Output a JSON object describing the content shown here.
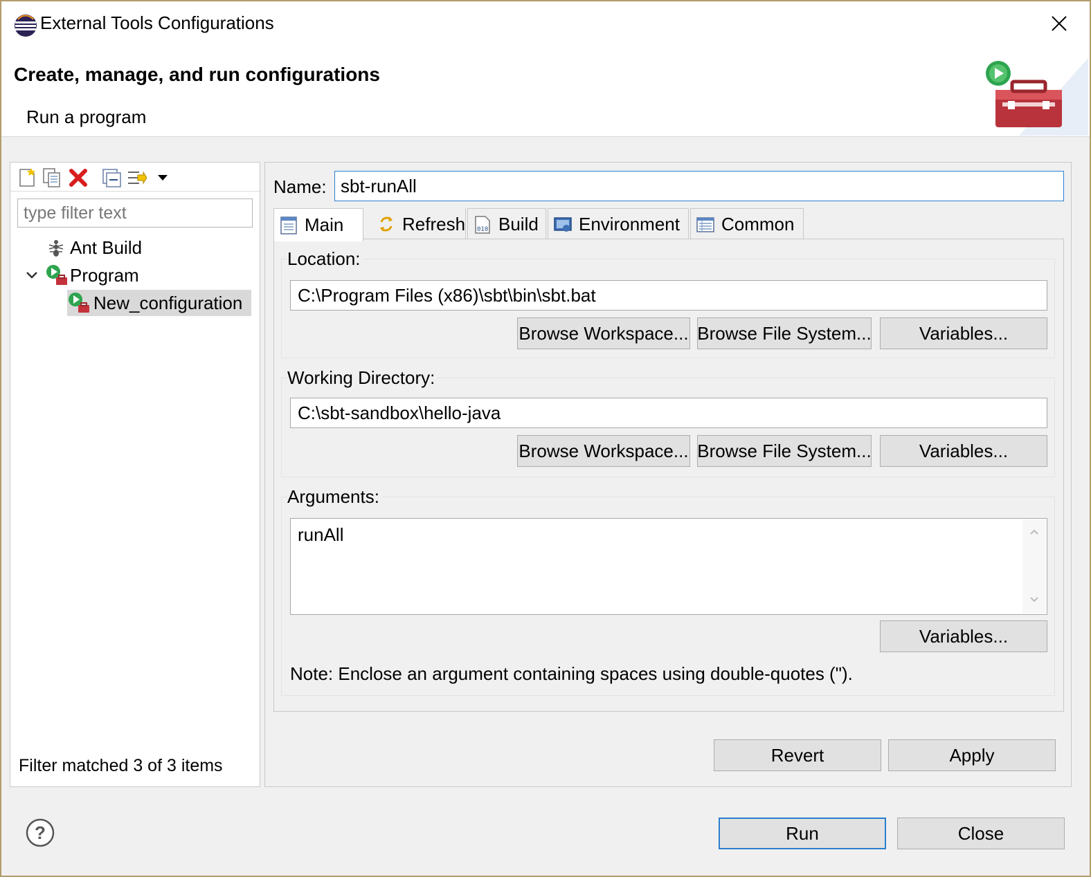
{
  "window": {
    "title": "External Tools Configurations",
    "close_glyph": "✕"
  },
  "header": {
    "title": "Create, manage, and run configurations",
    "subtitle": "Run a program"
  },
  "left": {
    "toolbar": {
      "items": [
        "new-config-icon",
        "duplicate-icon",
        "delete-icon",
        "collapse-all-icon",
        "filter-icon",
        "view-menu-icon"
      ]
    },
    "filter_placeholder": "type filter text",
    "tree": [
      {
        "label": "Ant Build",
        "icon": "ant-icon"
      },
      {
        "label": "Program",
        "icon": "program-icon",
        "expanded": true
      },
      {
        "label": "New_configuration",
        "icon": "program-config-icon",
        "selected": true
      }
    ],
    "status": "Filter matched 3 of 3 items"
  },
  "right": {
    "name_label": "Name:",
    "name_value": "sbt-runAll",
    "tabs": [
      {
        "label": "Main",
        "icon": "main-tab-icon",
        "active": true
      },
      {
        "label": "Refresh",
        "icon": "refresh-icon"
      },
      {
        "label": "Build",
        "icon": "build-icon"
      },
      {
        "label": "Environment",
        "icon": "environment-icon"
      },
      {
        "label": "Common",
        "icon": "common-icon"
      }
    ],
    "location": {
      "label": "Location:",
      "value": "C:\\Program Files (x86)\\sbt\\bin\\sbt.bat",
      "browse_workspace": "Browse Workspace...",
      "browse_fs": "Browse File System...",
      "variables": "Variables..."
    },
    "working_dir": {
      "label": "Working Directory:",
      "value": "C:\\sbt-sandbox\\hello-java",
      "browse_workspace": "Browse Workspace...",
      "browse_fs": "Browse File System...",
      "variables": "Variables..."
    },
    "arguments": {
      "label": "Arguments:",
      "value": "runAll",
      "variables": "Variables...",
      "note": "Note: Enclose an argument containing spaces using double-quotes (\")."
    },
    "revert": "Revert",
    "apply": "Apply"
  },
  "footer": {
    "run": "Run",
    "close": "Close",
    "help_icon": "help-icon"
  },
  "colors": {
    "accent_border": "#2b7fd0",
    "window_border": "#b19d6b"
  }
}
